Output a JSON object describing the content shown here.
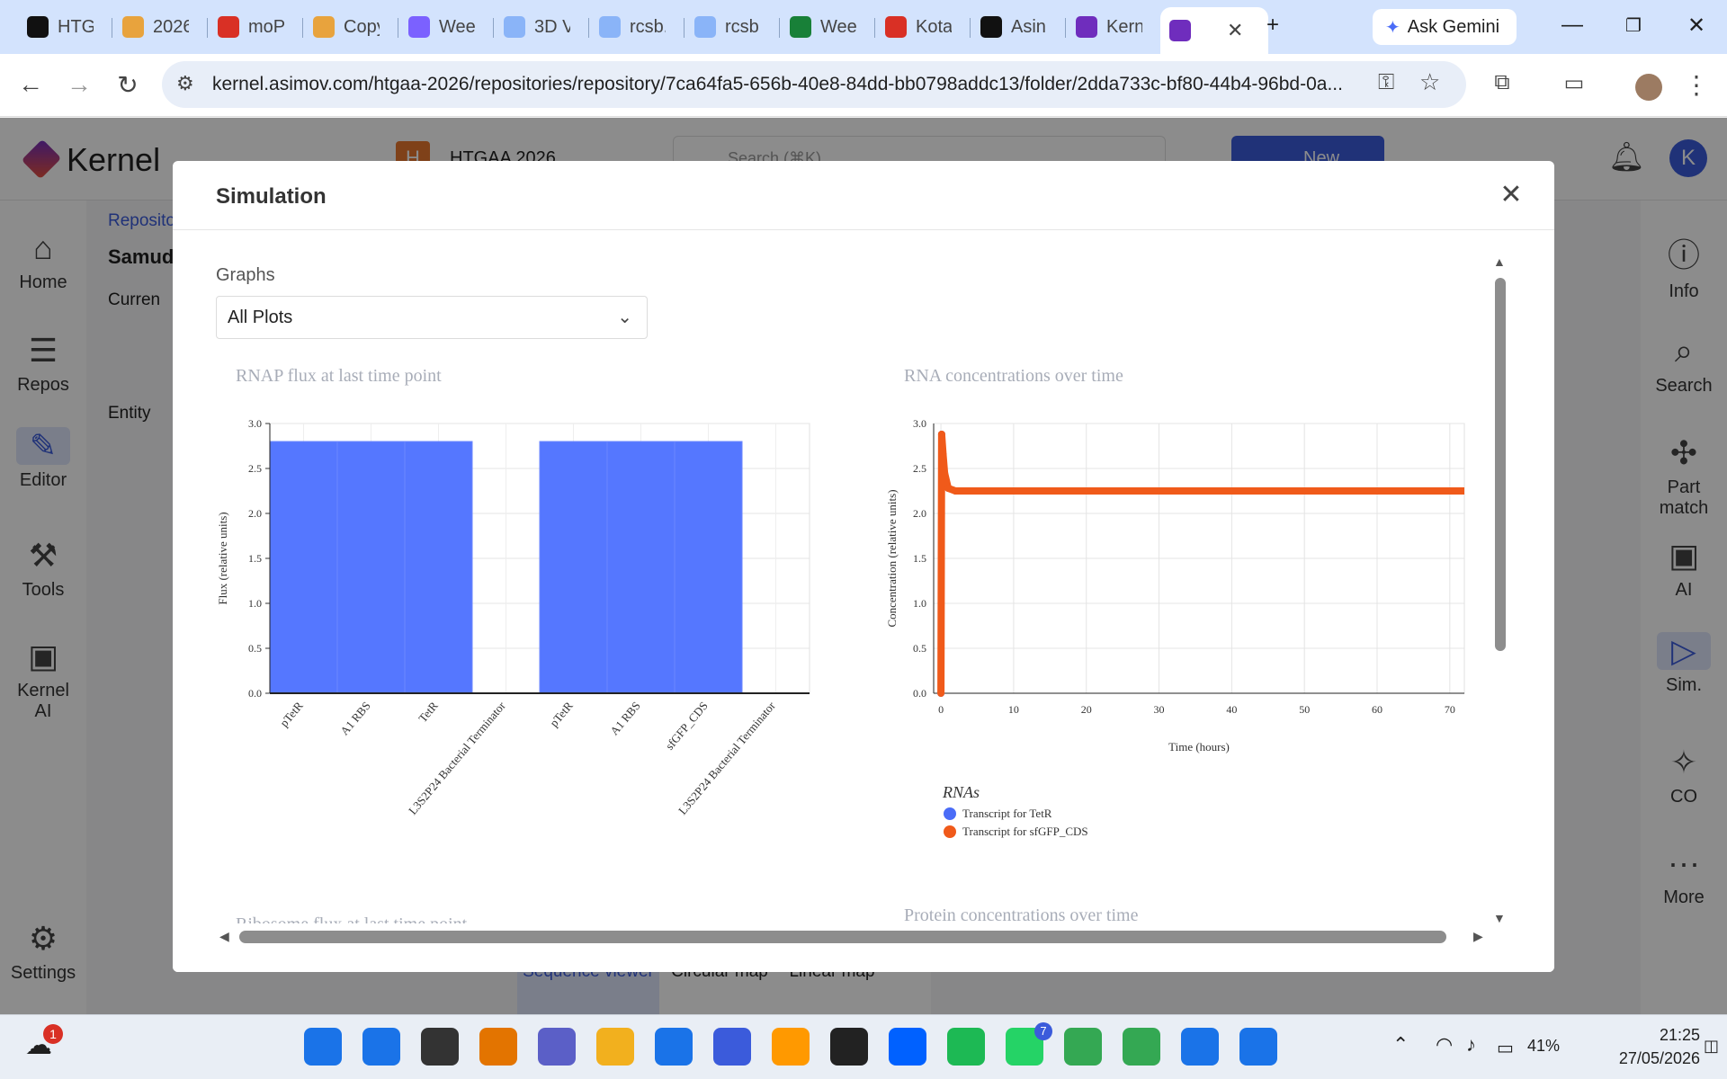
{
  "browser": {
    "tabs": [
      {
        "label": "HTG",
        "color": "#111111"
      },
      {
        "label": "2026",
        "color": "#e8a33d"
      },
      {
        "label": "moP",
        "color": "#d93025"
      },
      {
        "label": "Copy",
        "color": "#e8a33d"
      },
      {
        "label": "Wee",
        "color": "#7b61ff"
      },
      {
        "label": "3D V",
        "color": "#8ab4f8"
      },
      {
        "label": "rcsb.",
        "color": "#8ab4f8"
      },
      {
        "label": "rcsb",
        "color": "#8ab4f8"
      },
      {
        "label": "Wee",
        "color": "#188038"
      },
      {
        "label": "Kota",
        "color": "#d93025"
      },
      {
        "label": "Asin",
        "color": "#111111"
      },
      {
        "label": "Kern",
        "color": "#6f2dbd"
      }
    ],
    "ask_gemini": "Ask Gemini",
    "url": "kernel.asimov.com/htgaa-2026/repositories/repository/7ca64fa5-656b-40e8-84dd-bb0798addc13/folder/2dda733c-bf80-44b4-96bd-0a..."
  },
  "app": {
    "logo": "Kernel",
    "workspace": "HTGAA 2026",
    "workspace_initial": "H",
    "search_placeholder": "Search (⌘K)",
    "new_button": "New",
    "avatar_initial": "K",
    "left_nav": [
      "Home",
      "Repos",
      "Editor",
      "Tools",
      "Kernel AI",
      "Settings"
    ],
    "right_nav": [
      "Info",
      "Search",
      "Part match",
      "AI",
      "Sim.",
      "CO",
      "More"
    ],
    "bg_text": {
      "breadcrumb": "Reposito",
      "title": "Samud",
      "current": "Curren",
      "entity": "Entity"
    },
    "bottom_tabs": [
      "Sequence viewer",
      "Circular map",
      "Linear map"
    ]
  },
  "modal": {
    "title": "Simulation",
    "graphs_label": "Graphs",
    "graphs_value": "All Plots",
    "next_titles": [
      "Ribosome flux at last time point",
      "Protein concentrations over time"
    ]
  },
  "chart_data": [
    {
      "type": "bar",
      "title": "RNAP flux at last time point",
      "ylabel": "Flux (relative units)",
      "ylim": [
        0,
        3.0
      ],
      "yticks": [
        "0.0",
        "0.5",
        "1.0",
        "1.5",
        "2.0",
        "2.5",
        "3.0"
      ],
      "categories": [
        "pTetR",
        "A1 RBS",
        "TetR",
        "L3S2P24 Bacterial Terminator",
        "pTetR",
        "A1 RBS",
        "sfGFP_CDS",
        "L3S2P24 Bacterial Terminator"
      ],
      "values": [
        2.8,
        2.8,
        2.8,
        0,
        2.8,
        2.8,
        2.8,
        0
      ],
      "color": "#5577ff",
      "grid": true
    },
    {
      "type": "line",
      "title": "RNA concentrations over time",
      "xlabel": "Time (hours)",
      "ylabel": "Concentration (relative units)",
      "xlim": [
        -1,
        72
      ],
      "ylim": [
        0,
        3.0
      ],
      "xticks": [
        "0",
        "10",
        "20",
        "30",
        "40",
        "50",
        "60",
        "70"
      ],
      "yticks": [
        "0.0",
        "0.5",
        "1.0",
        "1.5",
        "2.0",
        "2.5",
        "3.0"
      ],
      "legend_title": "RNAs",
      "series": [
        {
          "name": "Transcript for TetR",
          "color": "#4a6cf7",
          "x": [
            0,
            0.1,
            0.3,
            0.5,
            1,
            2,
            10,
            20,
            30,
            40,
            50,
            60,
            72
          ],
          "y": [
            0,
            2.88,
            2.65,
            2.45,
            2.28,
            2.25,
            2.25,
            2.25,
            2.25,
            2.25,
            2.25,
            2.25,
            2.25
          ]
        },
        {
          "name": "Transcript for sfGFP_CDS",
          "color": "#f05a1a",
          "x": [
            0,
            0.1,
            0.3,
            0.5,
            1,
            2,
            10,
            20,
            30,
            40,
            50,
            60,
            72
          ],
          "y": [
            0,
            2.88,
            2.65,
            2.45,
            2.28,
            2.25,
            2.25,
            2.25,
            2.25,
            2.25,
            2.25,
            2.25,
            2.25
          ]
        }
      ],
      "grid": true
    }
  ],
  "taskbar": {
    "notification_count": "1",
    "whatsapp_badge": "7",
    "battery": "41%",
    "time": "21:25",
    "date": "27/05/2026"
  }
}
